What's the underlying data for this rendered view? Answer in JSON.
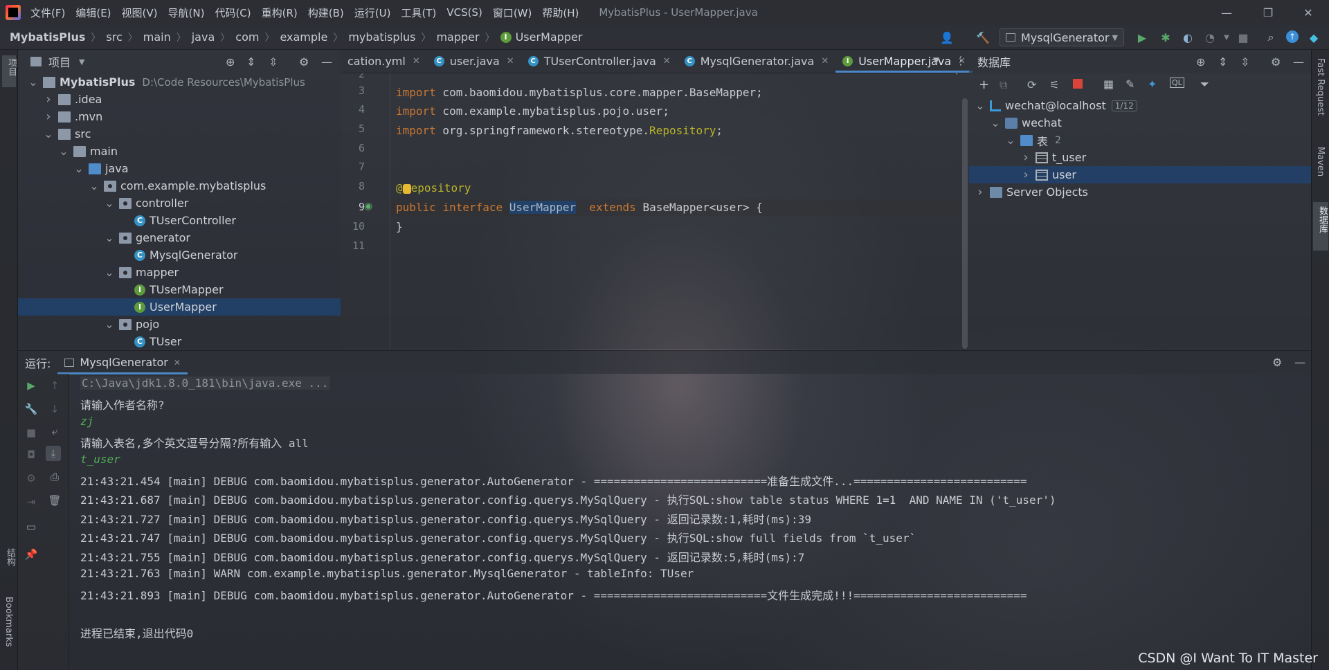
{
  "title_bar": {
    "menus": [
      "文件(F)",
      "编辑(E)",
      "视图(V)",
      "导航(N)",
      "代码(C)",
      "重构(R)",
      "构建(B)",
      "运行(U)",
      "工具(T)",
      "VCS(S)",
      "窗口(W)",
      "帮助(H)"
    ],
    "window_title": "MybatisPlus - UserMapper.java",
    "minimize": "—",
    "restore": "❐",
    "close": "✕"
  },
  "breadcrumb": [
    "MybatisPlus",
    "src",
    "main",
    "java",
    "com",
    "example",
    "mybatisplus",
    "mapper",
    "UserMapper"
  ],
  "toolbar": {
    "run_config": "MysqlGenerator"
  },
  "left_stripe": {
    "project": "项目",
    "structure": "结构",
    "bookmarks": "Bookmarks"
  },
  "project_panel": {
    "title": "项目",
    "tree": [
      {
        "label": "MybatisPlus",
        "path": "D:\\Code Resources\\MybatisPlus",
        "depth": 0,
        "icon": "project",
        "expanded": true
      },
      {
        "label": ".idea",
        "depth": 1,
        "icon": "folder",
        "expanded": false
      },
      {
        "label": ".mvn",
        "depth": 1,
        "icon": "folder",
        "expanded": false
      },
      {
        "label": "src",
        "depth": 1,
        "icon": "folder",
        "expanded": true
      },
      {
        "label": "main",
        "depth": 2,
        "icon": "folder",
        "expanded": true
      },
      {
        "label": "java",
        "depth": 3,
        "icon": "folder-blue",
        "expanded": true
      },
      {
        "label": "com.example.mybatisplus",
        "depth": 4,
        "icon": "package",
        "expanded": true
      },
      {
        "label": "controller",
        "depth": 5,
        "icon": "package",
        "expanded": true
      },
      {
        "label": "TUserController",
        "depth": 6,
        "icon": "class"
      },
      {
        "label": "generator",
        "depth": 5,
        "icon": "package",
        "expanded": true
      },
      {
        "label": "MysqlGenerator",
        "depth": 6,
        "icon": "class"
      },
      {
        "label": "mapper",
        "depth": 5,
        "icon": "package",
        "expanded": true
      },
      {
        "label": "TUserMapper",
        "depth": 6,
        "icon": "interface"
      },
      {
        "label": "UserMapper",
        "depth": 6,
        "icon": "interface",
        "selected": true
      },
      {
        "label": "pojo",
        "depth": 5,
        "icon": "package",
        "expanded": true
      },
      {
        "label": "TUser",
        "depth": 6,
        "icon": "class"
      }
    ]
  },
  "editor": {
    "tabs": [
      {
        "label": "cation.yml",
        "icon": "none"
      },
      {
        "label": "user.java",
        "icon": "class"
      },
      {
        "label": "TUserController.java",
        "icon": "class"
      },
      {
        "label": "MysqlGenerator.java",
        "icon": "class"
      },
      {
        "label": "UserMapper.java",
        "icon": "interface",
        "active": true
      }
    ],
    "line_numbers": [
      "2",
      "3",
      "4",
      "5",
      "6",
      "7",
      "8",
      "9",
      "10",
      "11"
    ],
    "code": {
      "l3_kw": "import",
      "l3_rest": " com.baomidou.mybatisplus.core.mapper.BaseMapper;",
      "l4_kw": "import",
      "l4_rest": " com.example.mybatisplus.pojo.user;",
      "l5_kw": "import",
      "l5_rest": " org.springframework.stereotype.",
      "l5_cls": "Repository",
      "l5_end": ";",
      "l8_at": "@",
      "l8_rest": "epository",
      "l9_kw1": "public",
      "l9_kw2": "interface",
      "l9_name": "UserMapper",
      "l9_kw3": "extends",
      "l9_rest": " BaseMapper<user> {",
      "l10": "}"
    }
  },
  "database_panel": {
    "title": "数据库",
    "tree": [
      {
        "label": "wechat@localhost",
        "badge": "1/12",
        "depth": 0,
        "expanded": true
      },
      {
        "label": "wechat",
        "depth": 1,
        "expanded": true
      },
      {
        "label": "表",
        "count": "2",
        "depth": 2,
        "expanded": true
      },
      {
        "label": "t_user",
        "depth": 3,
        "expanded": false
      },
      {
        "label": "user",
        "depth": 3,
        "expanded": false,
        "selected": true
      },
      {
        "label": "Server Objects",
        "depth": 0,
        "expanded": false
      }
    ]
  },
  "right_stripe": {
    "fast_request": "Fast Request",
    "maven": "Maven",
    "database": "数据库"
  },
  "run_panel": {
    "label": "运行:",
    "tab": "MysqlGenerator",
    "console": [
      {
        "text": "C:\\Java\\jdk1.8.0_181\\bin\\java.exe ...",
        "style": "gray"
      },
      {
        "text": "请输入作者名称?",
        "style": "normal"
      },
      {
        "text": "zj",
        "style": "green"
      },
      {
        "text": "请输入表名,多个英文逗号分隔?所有输入 all",
        "style": "normal"
      },
      {
        "text": "t_user",
        "style": "green"
      },
      {
        "text": "21:43:21.454 [main] DEBUG com.baomidou.mybatisplus.generator.AutoGenerator - ==========================准备生成文件...==========================",
        "style": "normal"
      },
      {
        "text": "21:43:21.687 [main] DEBUG com.baomidou.mybatisplus.generator.config.querys.MySqlQuery - 执行SQL:show table status WHERE 1=1  AND NAME IN ('t_user')",
        "style": "normal"
      },
      {
        "text": "21:43:21.727 [main] DEBUG com.baomidou.mybatisplus.generator.config.querys.MySqlQuery - 返回记录数:1,耗时(ms):39",
        "style": "normal"
      },
      {
        "text": "21:43:21.747 [main] DEBUG com.baomidou.mybatisplus.generator.config.querys.MySqlQuery - 执行SQL:show full fields from `t_user`",
        "style": "normal"
      },
      {
        "text": "21:43:21.755 [main] DEBUG com.baomidou.mybatisplus.generator.config.querys.MySqlQuery - 返回记录数:5,耗时(ms):7",
        "style": "normal"
      },
      {
        "text": "21:43:21.763 [main] WARN com.example.mybatisplus.generator.MysqlGenerator - tableInfo: TUser",
        "style": "normal"
      },
      {
        "text": "21:43:21.893 [main] DEBUG com.baomidou.mybatisplus.generator.AutoGenerator - ==========================文件生成完成!!!==========================",
        "style": "normal"
      },
      {
        "text": "",
        "style": "normal"
      },
      {
        "text": "进程已结束,退出代码0",
        "style": "normal"
      }
    ]
  },
  "watermark": "CSDN @I Want To IT Master"
}
